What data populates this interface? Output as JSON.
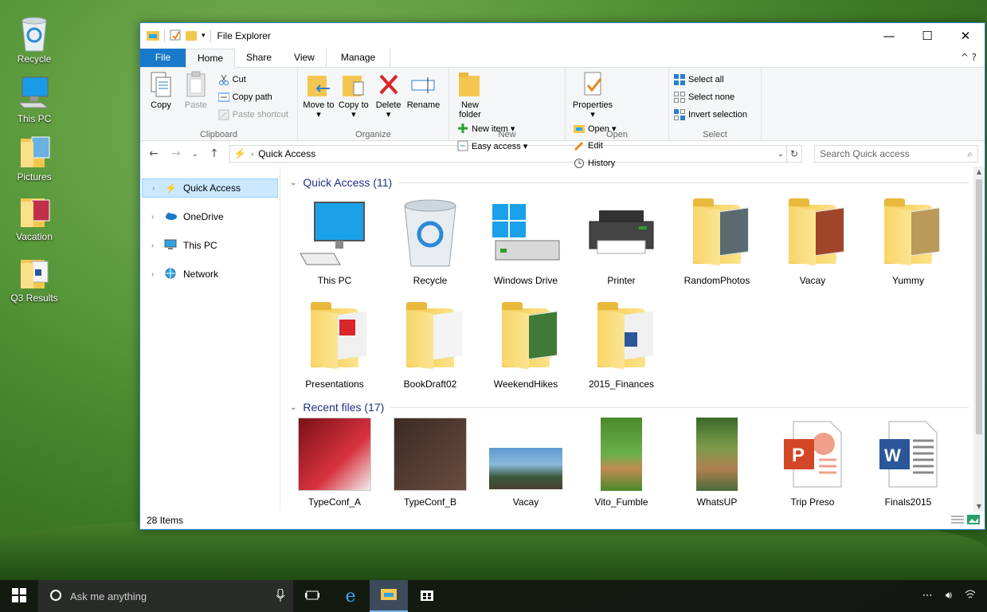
{
  "desktop": {
    "icons": [
      {
        "label": "Recycle"
      },
      {
        "label": "This PC"
      },
      {
        "label": "Pictures"
      },
      {
        "label": "Vacation"
      },
      {
        "label": "Q3 Results"
      }
    ]
  },
  "window": {
    "title": "File Explorer",
    "controls": {
      "minimize": "—",
      "maximize": "☐",
      "close": "✕"
    }
  },
  "ribbon": {
    "tabs": [
      "File",
      "Home",
      "Share",
      "View",
      "Manage"
    ],
    "active_tab": "Home",
    "right": "^ ?",
    "clipboard": {
      "copy": "Copy",
      "paste": "Paste",
      "cut": "Cut",
      "copy_path": "Copy path",
      "paste_shortcut": "Paste shortcut",
      "name": "Clipboard"
    },
    "organize": {
      "move_to": "Move to ▾",
      "copy_to": "Copy to ▾",
      "delete": "Delete ▾",
      "rename": "Rename",
      "name": "Organize"
    },
    "new": {
      "new_folder": "New folder",
      "new_item": "New item ▾",
      "easy_access": "Easy access ▾",
      "name": "New"
    },
    "open": {
      "properties": "Properties ▾",
      "open": "Open ▾",
      "edit": "Edit",
      "history": "History",
      "name": "Open"
    },
    "select": {
      "select_all": "Select all",
      "select_none": "Select none",
      "invert": "Invert selection",
      "name": "Select"
    }
  },
  "address": {
    "path": "Quick Access",
    "search_placeholder": "Search Quick access"
  },
  "nav": {
    "items": [
      {
        "label": "Quick Access"
      },
      {
        "label": "OneDrive"
      },
      {
        "label": "This PC"
      },
      {
        "label": "Network"
      }
    ]
  },
  "sections": {
    "quick": {
      "heading": "Quick Access (11)",
      "items": [
        {
          "label": "This PC"
        },
        {
          "label": "Recycle"
        },
        {
          "label": "Windows Drive"
        },
        {
          "label": "Printer"
        },
        {
          "label": "RandomPhotos"
        },
        {
          "label": "Vacay"
        },
        {
          "label": "Yummy"
        },
        {
          "label": "Presentations"
        },
        {
          "label": "BookDraft02"
        },
        {
          "label": "WeekendHikes"
        },
        {
          "label": "2015_Finances"
        }
      ]
    },
    "recent": {
      "heading": "Recent files (17)",
      "items": [
        {
          "label": "TypeConf_A"
        },
        {
          "label": "TypeConf_B"
        },
        {
          "label": "Vacay"
        },
        {
          "label": "Vito_Fumble"
        },
        {
          "label": "WhatsUP"
        },
        {
          "label": "Trip Preso"
        },
        {
          "label": "Finals2015"
        }
      ]
    }
  },
  "status": {
    "count": "28 Items"
  },
  "taskbar": {
    "search_placeholder": "Ask me anything"
  },
  "colors": {
    "accent": "#1979ca",
    "folder": "#f3c74f",
    "selection": "#cce8ff"
  }
}
